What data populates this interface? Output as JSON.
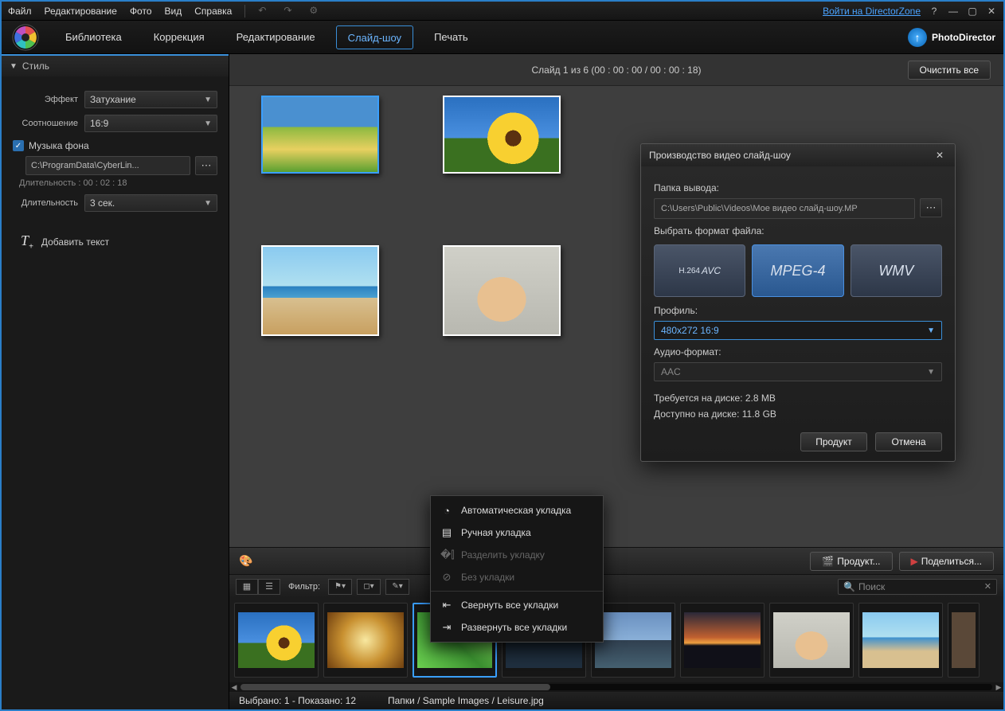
{
  "menubar": {
    "items": [
      "Файл",
      "Редактирование",
      "Фото",
      "Вид",
      "Справка"
    ],
    "link": "Войти на DirectorZone"
  },
  "brand": "PhotoDirector",
  "tabs": {
    "items": [
      "Библиотека",
      "Коррекция",
      "Редактирование",
      "Слайд-шоу",
      "Печать"
    ],
    "active": 3
  },
  "sidebar": {
    "panel_title": "Стиль",
    "effect_label": "Эффект",
    "effect_value": "Затухание",
    "ratio_label": "Соотношение",
    "ratio_value": "16:9",
    "bgmusic_label": "Музыка фона",
    "music_path": "C:\\ProgramData\\CyberLin...",
    "music_dur_label": "Длительность : 00 : 02 : 18",
    "duration_label": "Длительность",
    "duration_value": "3 сек.",
    "add_text": "Добавить текст"
  },
  "info": "Слайд   1 из   6 (00 : 00 : 00 / 00 : 00 : 18)",
  "clear_all": "Очистить все",
  "dialog": {
    "title": "Производство видео слайд-шоу",
    "out_folder_label": "Папка вывода:",
    "out_path": "C:\\Users\\Public\\Videos\\Мое видео слайд-шоу.MP",
    "format_label": "Выбрать формат файла:",
    "formats": [
      "H.264 AVC",
      "MPEG-4",
      "WMV"
    ],
    "profile_label": "Профиль:",
    "profile_value": "480x272 16:9",
    "audio_label": "Аудио-формат:",
    "audio_value": "AAC",
    "disk_req": "Требуется на диске: 2.8 MB",
    "disk_avail": "Доступно на диске: 11.8 GB",
    "ok": "Продукт",
    "cancel": "Отмена"
  },
  "context": {
    "auto": "Автоматическая укладка",
    "manual": "Ручная укладка",
    "split": "Разделить укладку",
    "none": "Без укладки",
    "collapse": "Свернуть все укладки",
    "expand": "Развернуть все укладки"
  },
  "transport": {
    "produce": "Продукт...",
    "share": "Поделиться..."
  },
  "filterbar": {
    "label": "Фильтр:",
    "search_placeholder": "Поиск"
  },
  "status": {
    "selected": "Выбрано: 1 - Показано: 12",
    "path": "Папки / Sample Images / Leisure.jpg"
  }
}
